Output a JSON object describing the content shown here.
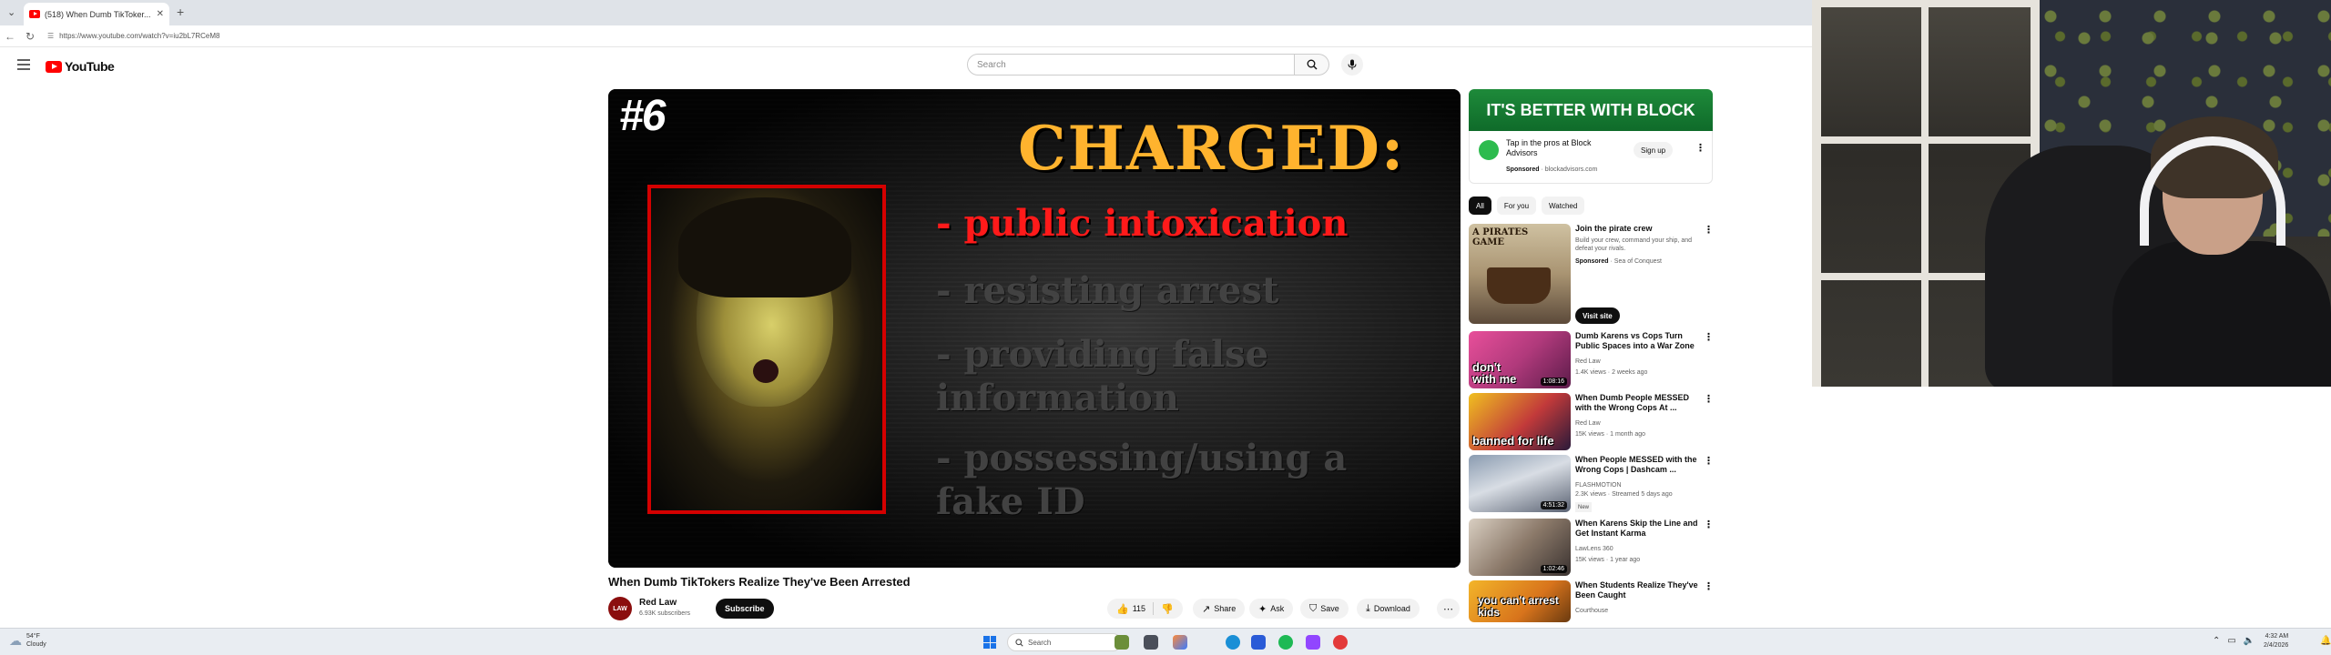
{
  "browser": {
    "tab_title": "(518) When Dumb TikToker...",
    "url": "https://www.youtube.com/watch?v=iu2bL7RCeM8"
  },
  "masthead": {
    "logo_text": "YouTube",
    "search_placeholder": "Search"
  },
  "player": {
    "rank": "#6",
    "headline": "CHARGED:",
    "charges": [
      "- public intoxication",
      "- resisting arrest",
      "- providing false information",
      "- possessing/using a fake ID"
    ]
  },
  "video": {
    "title": "When Dumb TikTokers Realize They've Been Arrested",
    "channel": "Red Law",
    "subscribers": "6.93K subscribers",
    "avatar_text": "LAW",
    "subscribe_label": "Subscribe",
    "likes": "115",
    "share_label": "Share",
    "ask_label": "Ask",
    "save_label": "Save",
    "download_label": "Download"
  },
  "sidebar": {
    "ad_banner": "IT'S BETTER WITH BLOCK",
    "ad_headline": "Tap in the pros at Block Advisors",
    "ad_sponsored": "Sponsored",
    "ad_domain": "blockadvisors.com",
    "ad_signup": "Sign up",
    "chips": [
      "All",
      "For you",
      "Watched"
    ],
    "promo": {
      "title": "Join the pirate crew",
      "desc": "Build your crew, command your ship, and defeat your rivals.",
      "sponsored": "Sponsored",
      "advertiser": "Sea of Conquest",
      "thumb_text": "A PIRATES GAME",
      "visit_label": "Visit site"
    },
    "recommendations": [
      {
        "title": "Dumb Karens vs Cops Turn Public Spaces into a War Zone",
        "channel": "Red Law",
        "meta": "1.4K views · 2 weeks ago",
        "duration": "1:08:16",
        "thumb_text": "don't with me",
        "badge": ""
      },
      {
        "title": "When Dumb People MESSED with the Wrong Cops At ...",
        "channel": "Red Law",
        "meta": "15K views · 1 month ago",
        "duration": "",
        "thumb_text": "banned for life",
        "badge": ""
      },
      {
        "title": "When People MESSED with the Wrong Cops | Dashcam ...",
        "channel": "FLASHMOTION",
        "meta": "2.3K views · Streamed 5 days ago",
        "duration": "4:51:32",
        "thumb_text": "",
        "badge": "New"
      },
      {
        "title": "When Karens Skip the Line and Get Instant Karma",
        "channel": "LawLens 360",
        "meta": "15K views · 1 year ago",
        "duration": "1:02:46",
        "thumb_text": "",
        "badge": ""
      },
      {
        "title": "When Students Realize They've Been Caught",
        "channel": "Courthouse",
        "meta": "",
        "duration": "",
        "thumb_text": "you can't arrest kids",
        "badge": ""
      }
    ]
  },
  "taskbar": {
    "temp": "54°F",
    "weather": "Cloudy",
    "search_placeholder": "Search",
    "time": "4:32 AM",
    "date": "2/4/2026"
  },
  "colors": {
    "yt_red": "#ff0000",
    "charged_orange": "#ffb32e",
    "charge_red": "#ff1a1a",
    "mugshot_border": "#d40000",
    "ad_green": "#1e8a3a"
  }
}
